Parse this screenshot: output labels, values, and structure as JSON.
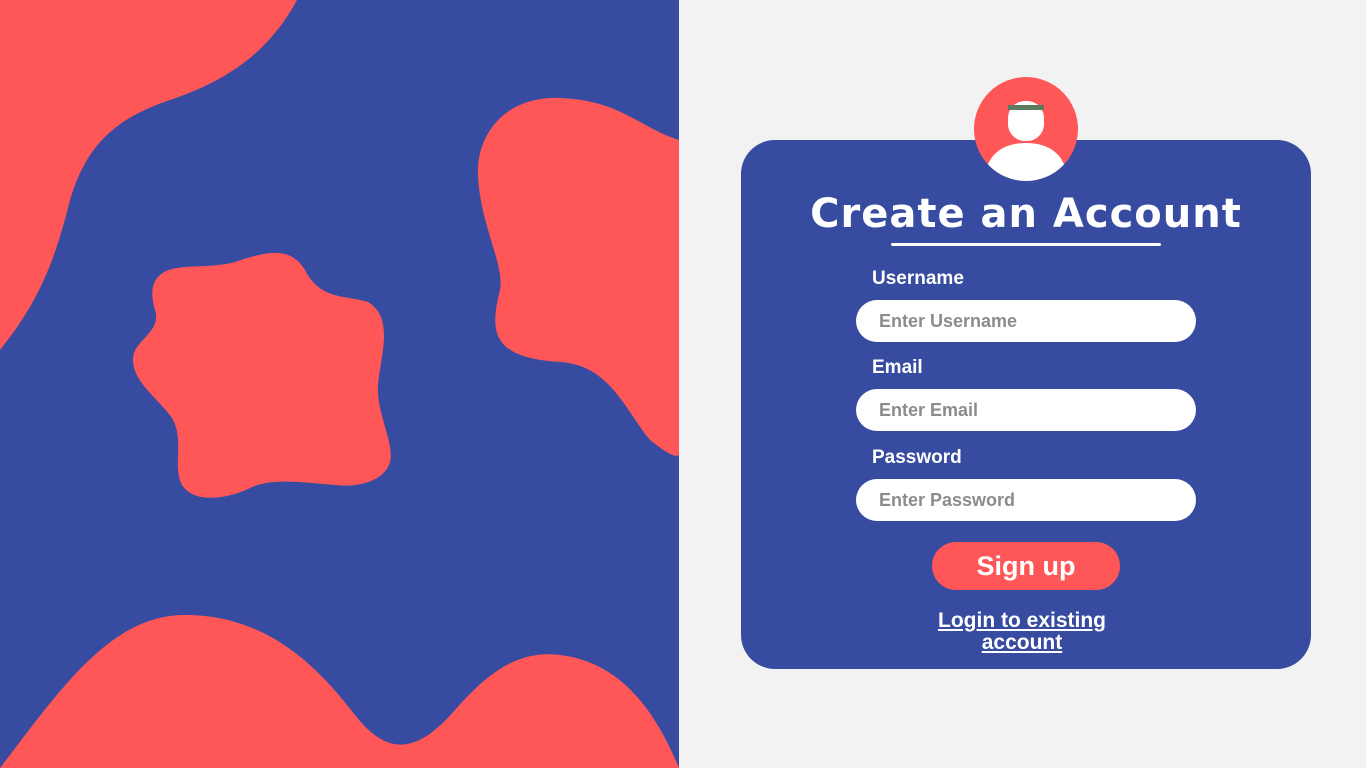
{
  "colors": {
    "primary_blue": "#374ca0",
    "accent_red": "#ff5757",
    "page_background": "#f2f2f2",
    "white": "#ffffff",
    "placeholder_gray": "#8c8c8c",
    "headband_green": "#5b7a5e"
  },
  "decor": {
    "blob_icons": [
      "top-left-blob",
      "right-blob",
      "center-star-blob",
      "bottom-blob"
    ]
  },
  "form": {
    "avatar_icon": "user-avatar-icon",
    "title": "Create an Account",
    "fields": [
      {
        "label": "Username",
        "placeholder": "Enter Username",
        "value": ""
      },
      {
        "label": "Email",
        "placeholder": "Enter Email",
        "value": ""
      },
      {
        "label": "Password",
        "placeholder": "Enter Password",
        "value": ""
      }
    ],
    "signup_label": "Sign up",
    "login_link_label": "Login to existing account"
  }
}
